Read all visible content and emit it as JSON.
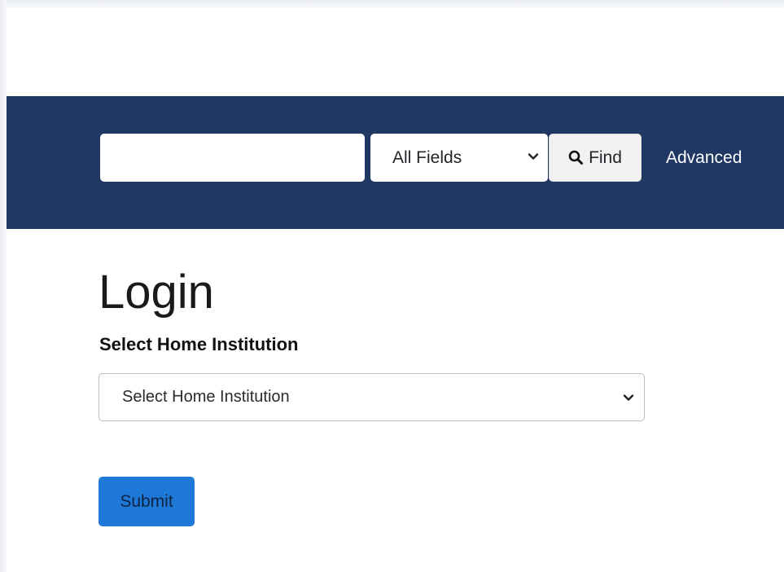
{
  "header": {
    "search": {
      "value": "",
      "placeholder": ""
    },
    "field_select": {
      "selected": "All Fields",
      "icon": "chevron-down-icon"
    },
    "find_button": {
      "label": "Find",
      "icon": "search-icon"
    },
    "advanced_link": "Advanced"
  },
  "main": {
    "title": "Login",
    "institution": {
      "label": "Select Home Institution",
      "selected": "Select Home Institution",
      "icon": "chevron-down-icon"
    },
    "submit_label": "Submit"
  },
  "colors": {
    "navbar": "#1f3864",
    "submit_button": "#1e78d7",
    "find_button": "#f1f1f1"
  }
}
